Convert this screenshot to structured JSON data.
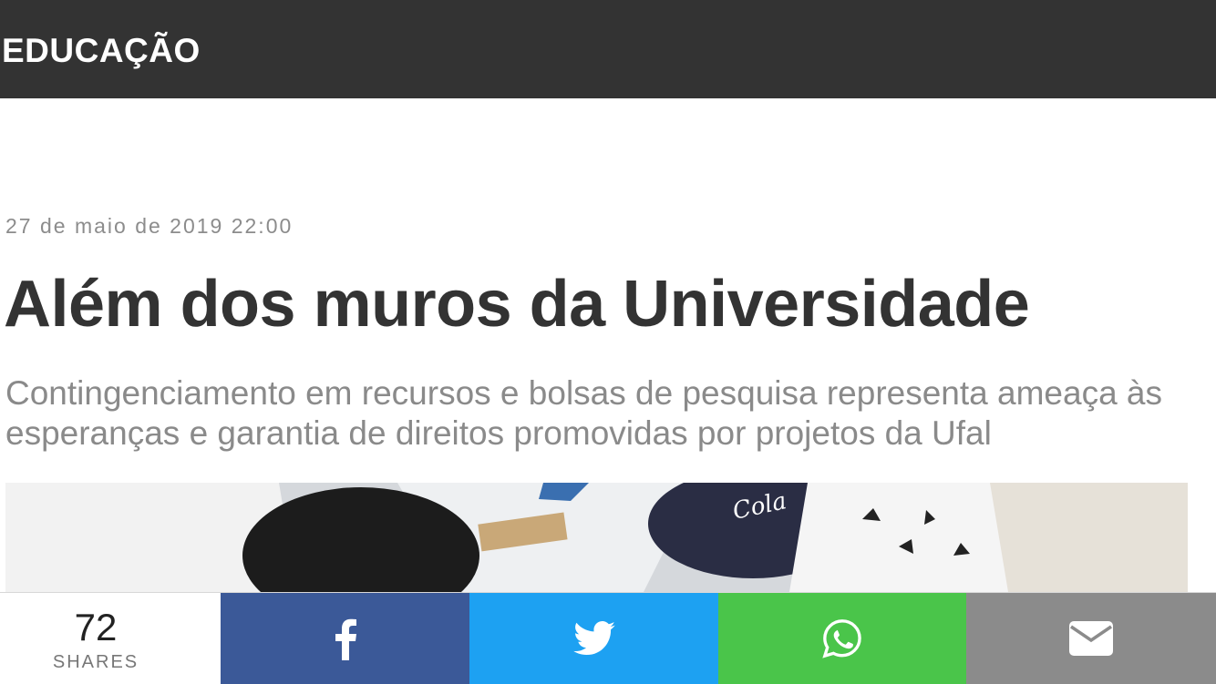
{
  "header": {
    "section": "EDUCAÇÃO"
  },
  "article": {
    "date": "27 de maio de 2019 22:00",
    "title": "Além dos muros da Universidade",
    "subtitle": "Contingenciamento em recursos e bolsas de pesquisa representa ameaça às esperanças e garantia de direitos promovidas por projetos da Ufal"
  },
  "share": {
    "count": "72",
    "count_label": "SHARES",
    "buttons": [
      {
        "icon": "facebook-icon",
        "color": "#3b5998"
      },
      {
        "icon": "twitter-icon",
        "color": "#1da1f2"
      },
      {
        "icon": "whatsapp-icon",
        "color": "#4ac54a"
      },
      {
        "icon": "email-icon",
        "color": "#8b8b8b"
      }
    ]
  },
  "colors": {
    "topbar": "#333333",
    "headline": "#333333",
    "muted": "#8a8a8a"
  }
}
